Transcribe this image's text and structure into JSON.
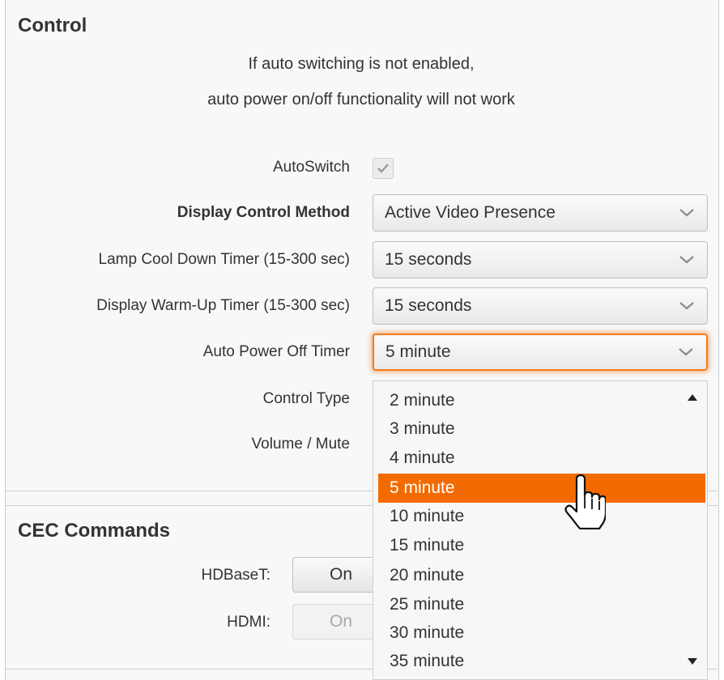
{
  "control": {
    "title": "Control",
    "notice_line1": "If auto switching is not enabled,",
    "notice_line2": "auto power on/off functionality will not work",
    "autoswitch_label": "AutoSwitch",
    "autoswitch_checked": true,
    "display_control_method_label": "Display Control Method",
    "display_control_method_value": "Active Video Presence",
    "lamp_cool_down_label": "Lamp Cool Down Timer (15-300 sec)",
    "lamp_cool_down_value": "15 seconds",
    "display_warmup_label": "Display Warm-Up Timer (15-300 sec)",
    "display_warmup_value": "15 seconds",
    "auto_power_off_label": "Auto Power Off Timer",
    "auto_power_off_value": "5 minute",
    "control_type_label": "Control Type",
    "volume_mute_label": "Volume / Mute"
  },
  "auto_power_off_dropdown": {
    "options": [
      "2 minute",
      "3 minute",
      "4 minute",
      "5 minute",
      "10 minute",
      "15 minute",
      "20 minute",
      "25 minute",
      "30 minute",
      "35 minute"
    ],
    "selected": "5 minute"
  },
  "cec": {
    "title": "CEC Commands",
    "hdbaset_label": "HDBaseT:",
    "hdbaset_on_label": "On",
    "hdmi_label": "HDMI:",
    "hdmi_on_label": "On"
  },
  "colors": {
    "accent": "#f36b00",
    "focus_ring": "#f07b1d"
  },
  "icons": {
    "checkbox": "check-icon",
    "select": "chevron-down-icon",
    "scroll_up": "triangle-up-icon",
    "scroll_down": "triangle-down-icon",
    "cursor": "hand-pointer-icon"
  }
}
